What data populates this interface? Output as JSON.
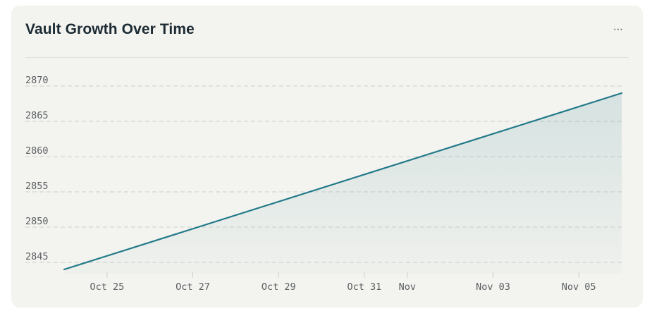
{
  "card": {
    "title": "Vault Growth Over Time",
    "more_label": "⋯"
  },
  "chart_data": {
    "type": "area",
    "title": "Vault Growth Over Time",
    "xlabel": "",
    "ylabel": "",
    "x": [
      "2024-10-24",
      "2024-11-06"
    ],
    "series": [
      {
        "values": [
          2844,
          2869
        ]
      }
    ],
    "ylim": [
      2844,
      2872
    ],
    "yticks": [
      2845,
      2850,
      2855,
      2860,
      2865,
      2870
    ],
    "xticks": [
      {
        "date": "2024-10-25",
        "label": "Oct 25"
      },
      {
        "date": "2024-10-27",
        "label": "Oct 27"
      },
      {
        "date": "2024-10-29",
        "label": "Oct 29"
      },
      {
        "date": "2024-10-31",
        "label": "Oct 31"
      },
      {
        "date": "2024-11-01",
        "label": "Nov"
      },
      {
        "date": "2024-11-03",
        "label": "Nov 03"
      },
      {
        "date": "2024-11-05",
        "label": "Nov 05"
      }
    ],
    "grid": true,
    "legend": "none",
    "colors": {
      "line": "#237a8a",
      "area": "#237a8a",
      "grid": "#cfcfca"
    }
  }
}
